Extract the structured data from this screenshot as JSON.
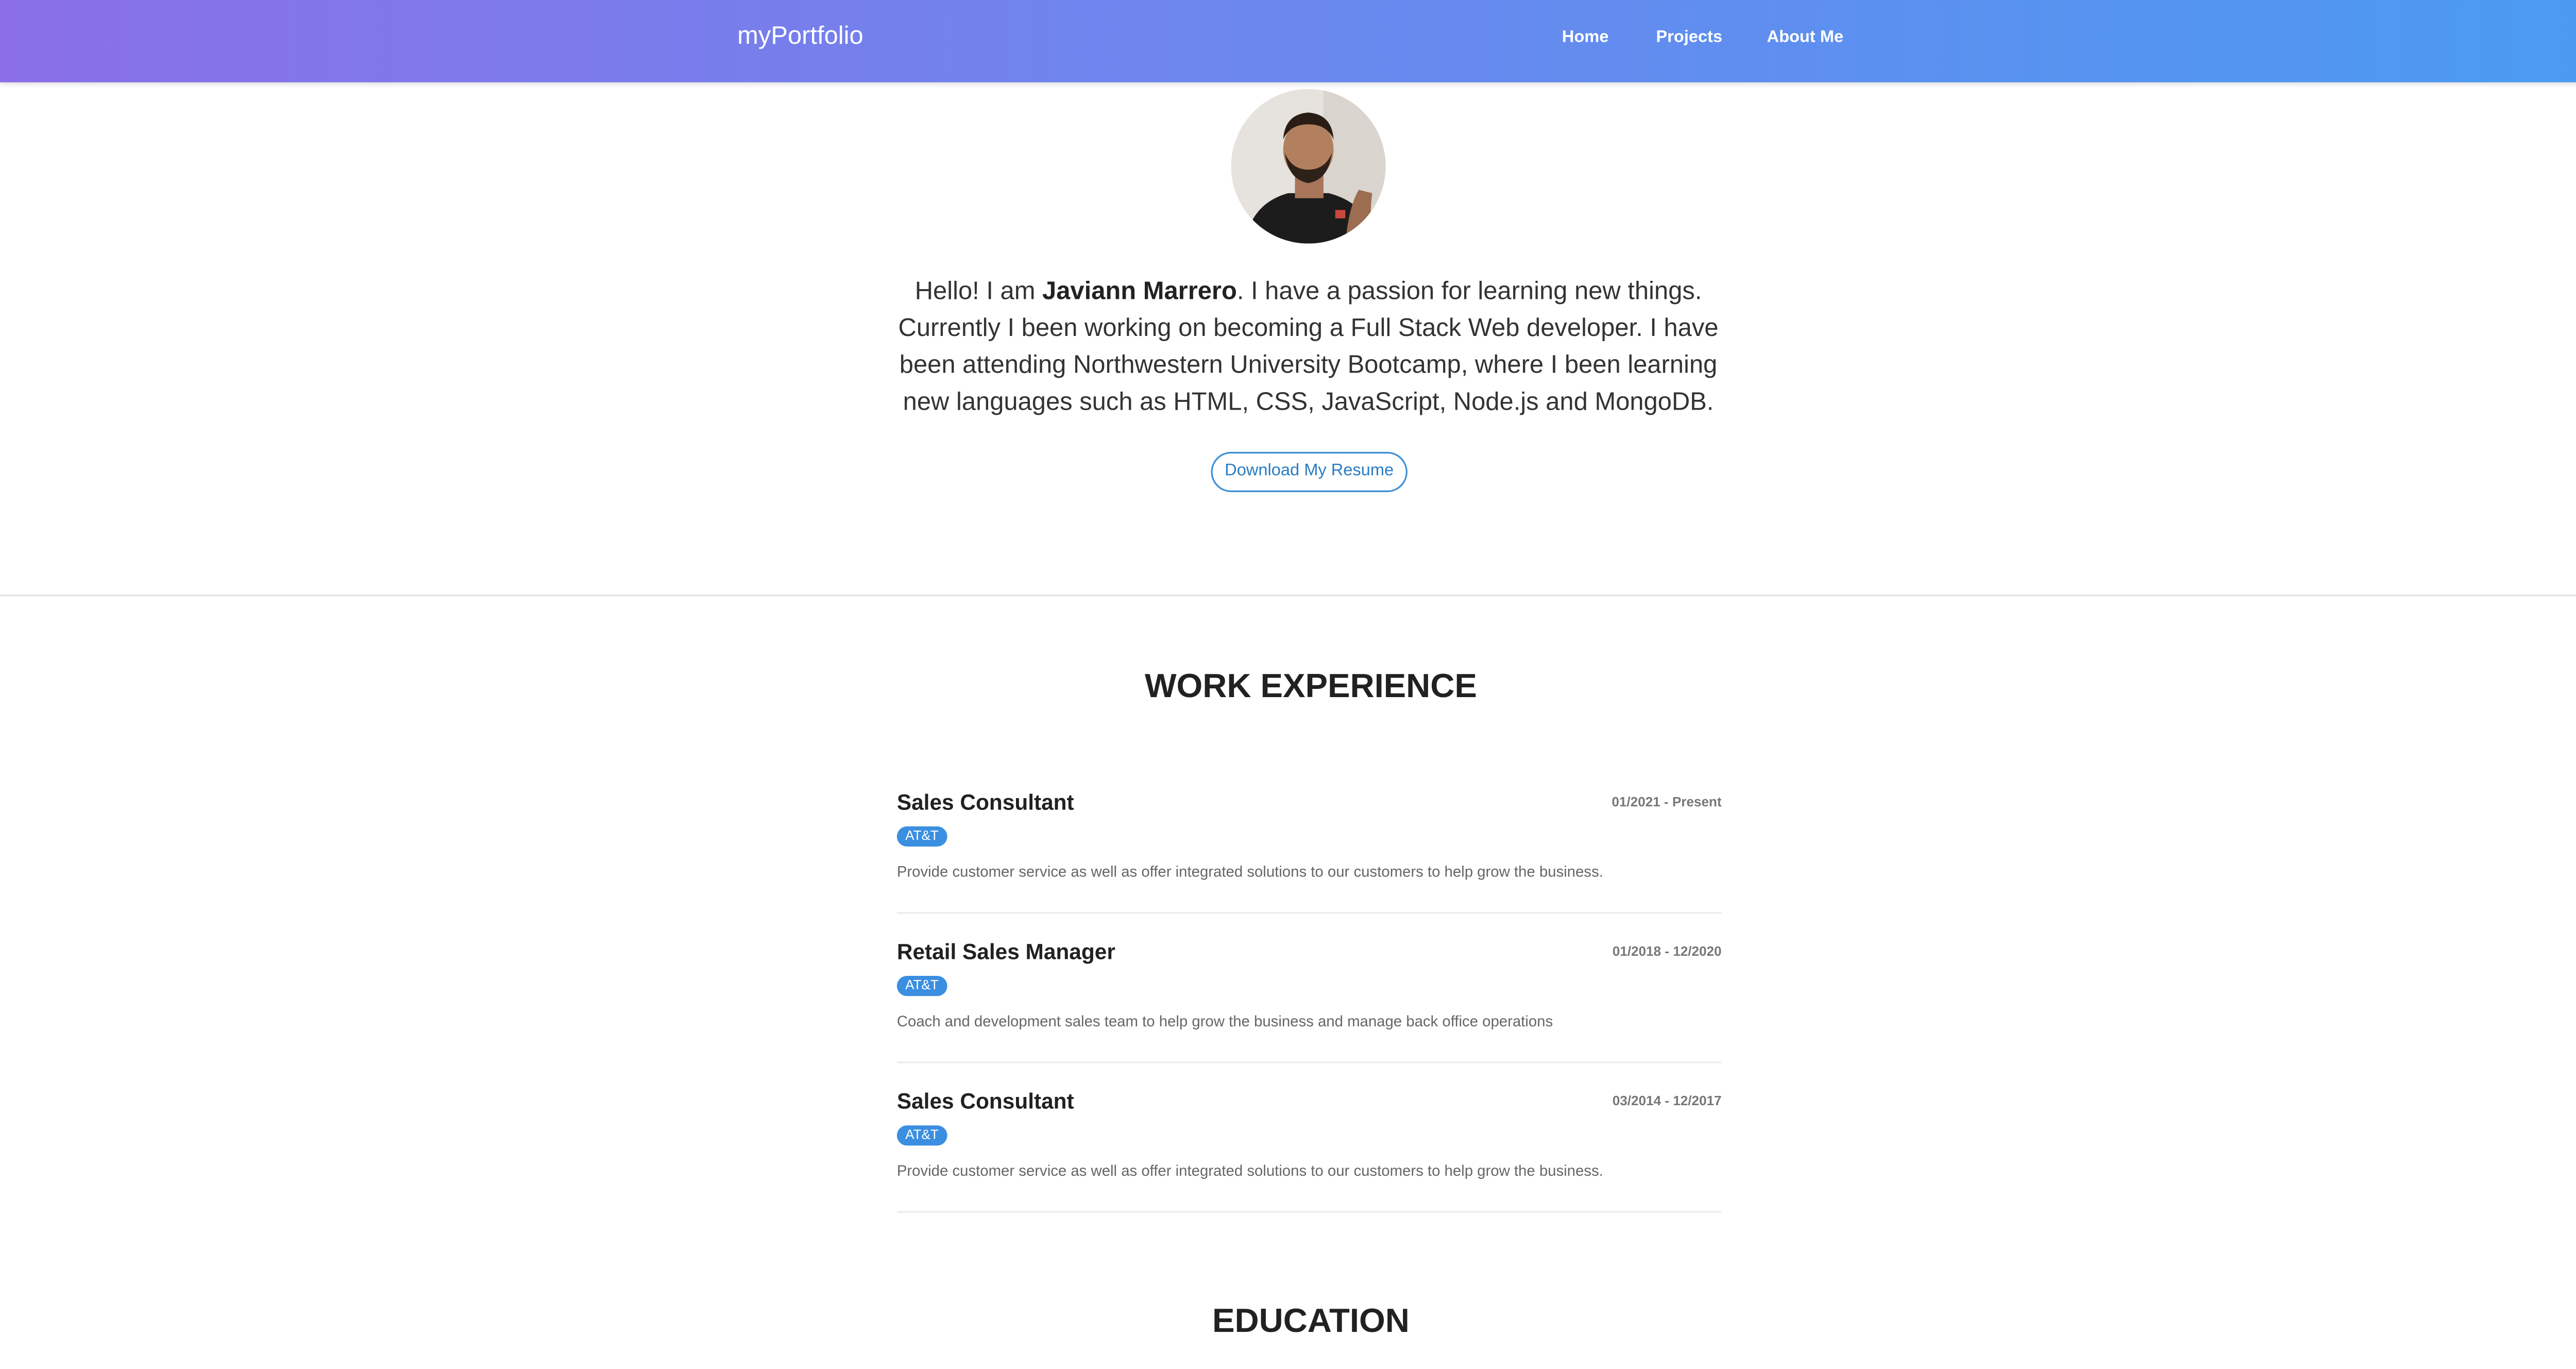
{
  "navbar": {
    "brand": "myPortfolio",
    "links": [
      "Home",
      "Projects",
      "About Me"
    ]
  },
  "hero": {
    "intro_before_name": "Hello! I am ",
    "name": "Javiann Marrero",
    "intro_after_name": ". I have a passion for learning new things. Currently I been working on becoming a Full Stack Web developer. I have been attending Northwestern University Bootcamp, where I been learning new languages such as HTML, CSS, JavaScript, Node.js and MongoDB.",
    "resume_button": "Download My Resume"
  },
  "work_experience": {
    "title": "WORK EXPERIENCE",
    "jobs": [
      {
        "title": "Sales Consultant",
        "company": "AT&T",
        "dates": "01/2021 - Present",
        "description": "Provide customer service as well as offer integrated solutions to our customers to help grow the business."
      },
      {
        "title": "Retail Sales Manager",
        "company": "AT&T",
        "dates": "01/2018 - 12/2020",
        "description": "Coach and development sales team to help grow the business and manage back office operations"
      },
      {
        "title": "Sales Consultant",
        "company": "AT&T",
        "dates": "03/2014 - 12/2017",
        "description": "Provide customer service as well as offer integrated solutions to our customers to help grow the business."
      }
    ]
  },
  "education": {
    "title": "EDUCATION"
  },
  "colors": {
    "navbar_gradient_start": "#8a6fe8",
    "navbar_gradient_end": "#4a9bf2",
    "badge": "#3b8fe0",
    "button_border": "#3d8fd6"
  }
}
